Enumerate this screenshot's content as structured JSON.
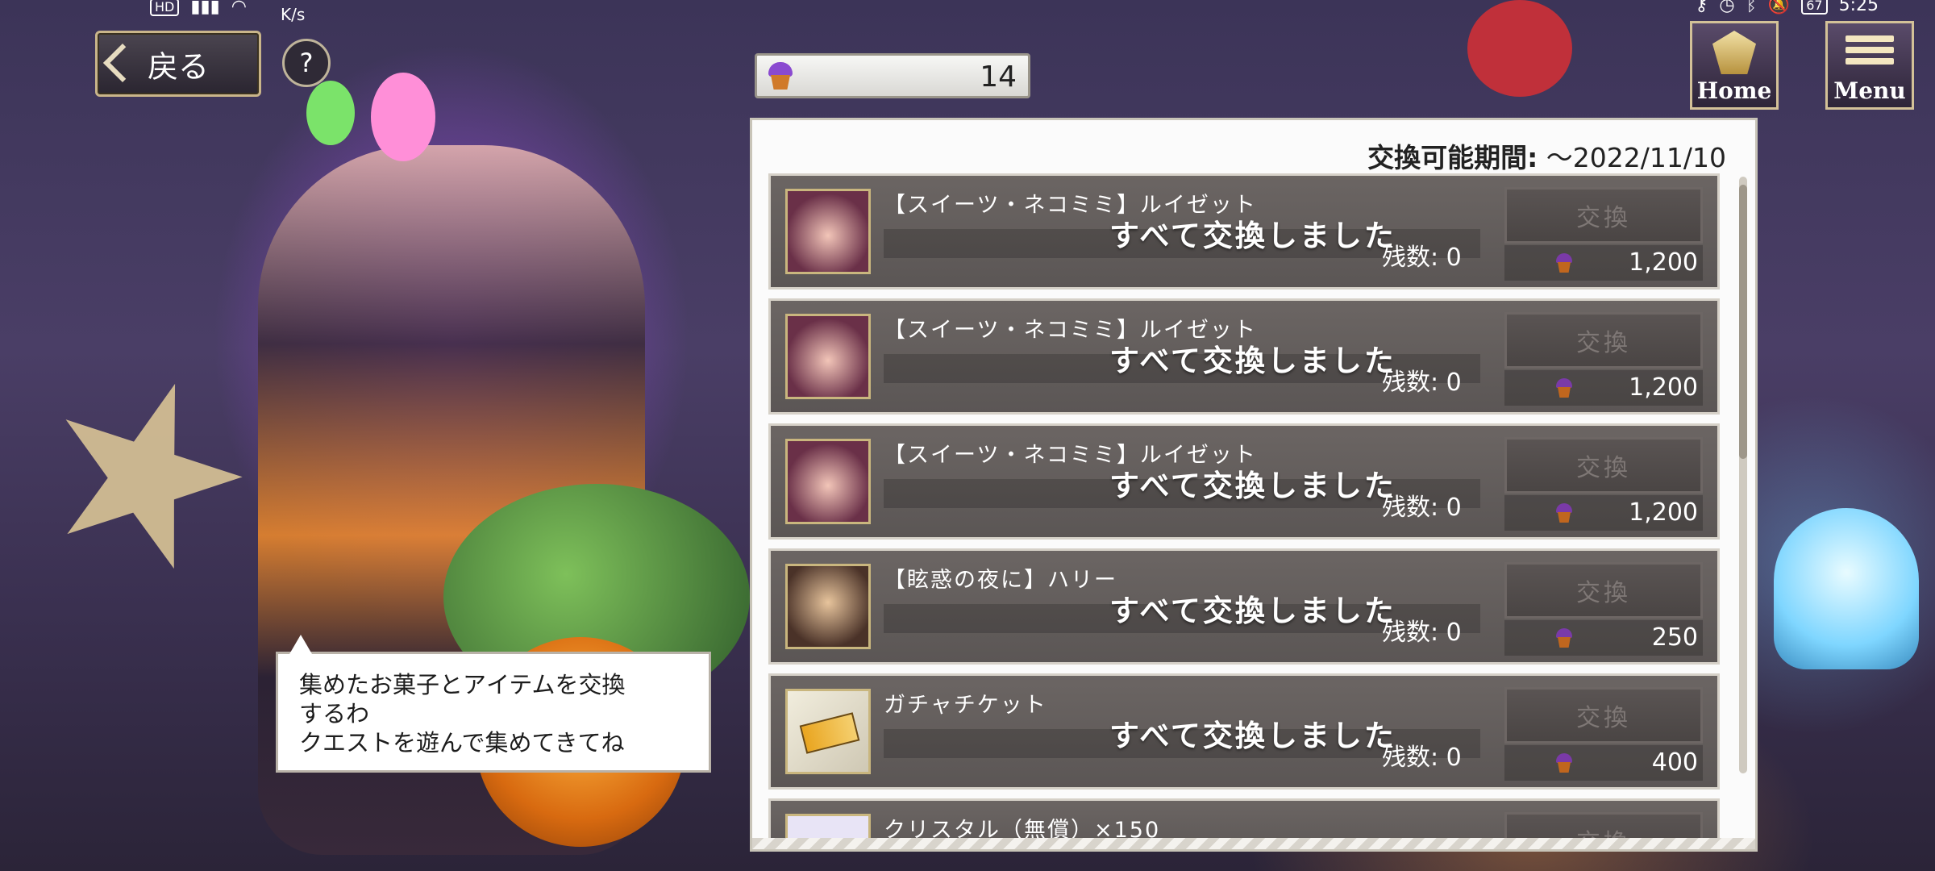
{
  "status_bar": {
    "hd": "HD",
    "speed_unit": "K/s",
    "battery": "67",
    "time": "5:25"
  },
  "nav": {
    "back_label": "戻る",
    "help_label": "?",
    "home_label": "Home",
    "menu_label": "Menu"
  },
  "currency": {
    "icon": "cupcake-icon",
    "amount": "14"
  },
  "speech": {
    "line1": "集めたお菓子とアイテムを交換",
    "line2": "するわ",
    "line3": "クエストを遊んで集めてきてね"
  },
  "panel": {
    "period_label": "交換可能期間:",
    "period_value": "～2022/11/10",
    "items": [
      {
        "name": "【スイーツ・ネコミミ】ルイゼット",
        "status": "すべて交換しました",
        "remain": "残数: 0",
        "button": "交換",
        "cost": "1,200"
      },
      {
        "name": "【スイーツ・ネコミミ】ルイゼット",
        "status": "すべて交換しました",
        "remain": "残数: 0",
        "button": "交換",
        "cost": "1,200"
      },
      {
        "name": "【スイーツ・ネコミミ】ルイゼット",
        "status": "すべて交換しました",
        "remain": "残数: 0",
        "button": "交換",
        "cost": "1,200"
      },
      {
        "name": "【眩惑の夜に】ハリー",
        "status": "すべて交換しました",
        "remain": "残数: 0",
        "button": "交換",
        "cost": "250"
      },
      {
        "name": "ガチャチケット",
        "status": "すべて交換しました",
        "remain": "残数: 0",
        "button": "交換",
        "cost": "400"
      },
      {
        "name": "クリスタル（無償）×150",
        "button": "交換"
      }
    ]
  },
  "colors": {
    "accent_gold": "#c9b58a",
    "row_bg": "#6b6563",
    "panel_bg": "#fbfbfb"
  }
}
